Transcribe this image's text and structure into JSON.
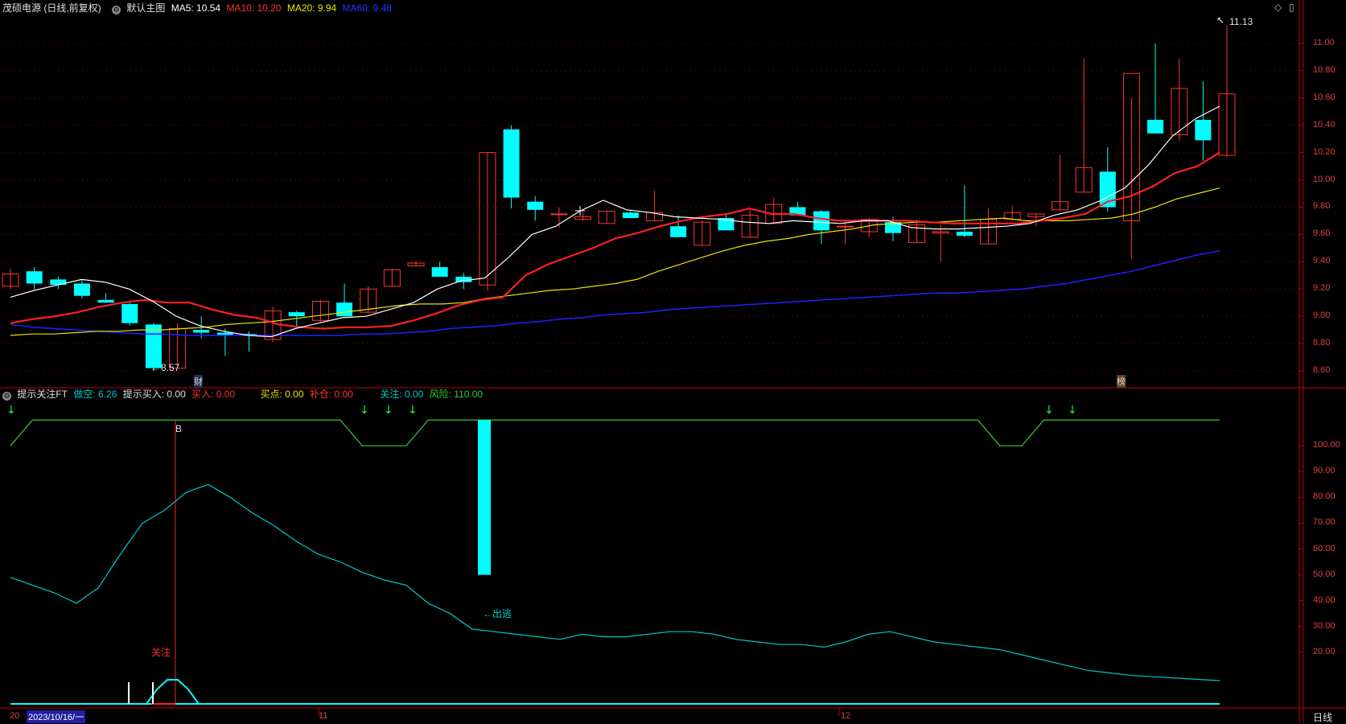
{
  "header": {
    "stock_title": "茂硕电源 (日线,前复权)",
    "main_chart_name": "默认主图",
    "ma5": "MA5: 10.54",
    "ma10": "MA10: 10.20",
    "ma20": "MA20: 9.94",
    "ma60": "MA60: 9.48"
  },
  "sub_header": {
    "indicator_name": "提示关注FT",
    "short": "做空: 6.26",
    "hint_buy": "提示买入: 0.00",
    "buy": "买入: 0.00",
    "buy_point": "买点: 0.00",
    "add": "补仓: 0.00",
    "watch": "关注: 0.00",
    "risk": "风险: 110.00"
  },
  "colors": {
    "up": "#ff3333",
    "down": "#00ffff",
    "ma5": "#ffffff",
    "ma10": "#ff2020",
    "ma20": "#e6e600",
    "ma60": "#2020ff",
    "grid": "#5a0000",
    "axis": "#c00000",
    "osc": "#00c8c8",
    "risk": "#33cc33",
    "arrow": "#33ee33"
  },
  "annotations": {
    "high_label": "11.13",
    "low_label": "8.57",
    "finance_mark": "财",
    "rank_mark": "榜",
    "b_mark": "B",
    "watch_mark": "关注",
    "escape_label": "←出逃"
  },
  "x_axis": {
    "labels": [
      "11",
      "12"
    ],
    "cursor_date": "2023/10/16/一",
    "left_stub": "20",
    "period": "日线"
  },
  "chart_data": [
    {
      "type": "candlestick",
      "ylim": [
        8.5,
        11.2
      ],
      "yticks": [
        "11.00",
        "10.80",
        "10.60",
        "10.40",
        "10.20",
        "10.00",
        "9.80",
        "9.60",
        "9.40",
        "9.20",
        "9.00",
        "8.80",
        "8.60"
      ],
      "ohlc": [
        [
          9.22,
          9.35,
          9.2,
          9.31
        ],
        [
          9.33,
          9.36,
          9.2,
          9.24
        ],
        [
          9.27,
          9.29,
          9.2,
          9.23
        ],
        [
          9.24,
          9.27,
          9.13,
          9.15
        ],
        [
          9.12,
          9.17,
          9.1,
          9.1
        ],
        [
          9.09,
          9.1,
          8.93,
          8.95
        ],
        [
          8.94,
          8.95,
          8.6,
          8.62
        ],
        [
          8.62,
          8.95,
          8.62,
          8.91
        ],
        [
          8.9,
          9.0,
          8.84,
          8.88
        ],
        [
          8.88,
          8.91,
          8.71,
          8.86
        ],
        [
          8.87,
          8.89,
          8.74,
          8.86
        ],
        [
          8.83,
          9.07,
          8.81,
          9.04
        ],
        [
          9.03,
          9.04,
          8.92,
          9.0
        ],
        [
          8.97,
          9.12,
          8.96,
          9.11
        ],
        [
          9.1,
          9.24,
          9.0,
          9.0
        ],
        [
          9.03,
          9.22,
          9.02,
          9.2
        ],
        [
          9.22,
          9.35,
          9.22,
          9.34
        ],
        [
          9.37,
          9.4,
          9.37,
          9.39
        ],
        [
          9.36,
          9.4,
          9.29,
          9.29
        ],
        [
          9.29,
          9.32,
          9.2,
          9.25
        ],
        [
          9.23,
          10.2,
          9.19,
          10.2
        ],
        [
          10.37,
          10.4,
          9.79,
          9.87
        ],
        [
          9.84,
          9.88,
          9.7,
          9.78
        ],
        [
          9.75,
          9.8,
          9.65,
          9.75
        ],
        [
          9.71,
          9.76,
          9.7,
          9.73
        ],
        [
          9.68,
          9.77,
          9.68,
          9.77
        ],
        [
          9.76,
          9.77,
          9.73,
          9.72
        ],
        [
          9.7,
          9.92,
          9.7,
          9.76
        ],
        [
          9.66,
          9.74,
          9.59,
          9.58
        ],
        [
          9.52,
          9.7,
          9.52,
          9.69
        ],
        [
          9.72,
          9.75,
          9.63,
          9.63
        ],
        [
          9.58,
          9.78,
          9.58,
          9.74
        ],
        [
          9.68,
          9.87,
          9.68,
          9.82
        ],
        [
          9.8,
          9.84,
          9.74,
          9.74
        ],
        [
          9.77,
          9.78,
          9.53,
          9.63
        ],
        [
          9.66,
          9.69,
          9.53,
          9.66
        ],
        [
          9.62,
          9.72,
          9.58,
          9.71
        ],
        [
          9.69,
          9.73,
          9.55,
          9.61
        ],
        [
          9.54,
          9.71,
          9.54,
          9.67
        ],
        [
          9.61,
          9.67,
          9.4,
          9.62
        ],
        [
          9.62,
          9.96,
          9.58,
          9.59
        ],
        [
          9.53,
          9.79,
          9.53,
          9.71
        ],
        [
          9.71,
          9.81,
          9.7,
          9.76
        ],
        [
          9.73,
          9.75,
          9.66,
          9.75
        ],
        [
          9.78,
          10.18,
          9.78,
          9.84
        ],
        [
          9.91,
          10.89,
          9.91,
          10.09
        ],
        [
          10.06,
          10.24,
          9.77,
          9.8
        ],
        [
          9.7,
          10.6,
          9.42,
          10.78
        ],
        [
          10.44,
          11.0,
          10.34,
          10.34
        ],
        [
          10.33,
          10.89,
          10.29,
          10.67
        ],
        [
          10.44,
          10.72,
          10.14,
          10.29
        ],
        [
          10.18,
          11.13,
          10.17,
          10.63
        ]
      ],
      "ma5": [
        9.14,
        9.19,
        9.23,
        9.27,
        9.25,
        9.2,
        9.11,
        9.0,
        8.93,
        8.89,
        8.86,
        8.85,
        8.91,
        8.95,
        8.99,
        9.0,
        9.05,
        9.1,
        9.2,
        9.26,
        9.28,
        9.43,
        9.6,
        9.66,
        9.77,
        9.85,
        9.78,
        9.76,
        9.73,
        9.72,
        9.71,
        9.69,
        9.68,
        9.7,
        9.69,
        9.68,
        9.7,
        9.7,
        9.65,
        9.64,
        9.64,
        9.65,
        9.66,
        9.68,
        9.74,
        9.78,
        9.85,
        9.94,
        10.11,
        10.32,
        10.45,
        10.54
      ],
      "ma10": [
        8.95,
        8.98,
        9.0,
        9.03,
        9.07,
        9.1,
        9.12,
        9.1,
        9.1,
        9.05,
        9.01,
        8.99,
        8.94,
        8.92,
        8.91,
        8.92,
        8.92,
        8.93,
        8.97,
        9.02,
        9.08,
        9.12,
        9.14,
        9.3,
        9.38,
        9.44,
        9.5,
        9.57,
        9.61,
        9.66,
        9.7,
        9.73,
        9.75,
        9.79,
        9.75,
        9.75,
        9.72,
        9.7,
        9.7,
        9.7,
        9.7,
        9.69,
        9.68,
        9.68,
        9.68,
        9.68,
        9.7,
        9.72,
        9.75,
        9.84,
        9.88,
        9.95,
        10.05,
        10.1,
        10.2
      ],
      "ma20": [
        8.86,
        8.87,
        8.87,
        8.88,
        8.89,
        8.89,
        8.9,
        8.9,
        8.91,
        8.92,
        8.94,
        8.95,
        8.96,
        8.98,
        9.0,
        9.02,
        9.04,
        9.06,
        9.08,
        9.09,
        9.09,
        9.1,
        9.13,
        9.15,
        9.17,
        9.19,
        9.2,
        9.22,
        9.24,
        9.27,
        9.33,
        9.38,
        9.43,
        9.48,
        9.52,
        9.55,
        9.57,
        9.6,
        9.62,
        9.64,
        9.67,
        9.68,
        9.69,
        9.69,
        9.7,
        9.71,
        9.72,
        9.7,
        9.7,
        9.7,
        9.71,
        9.72,
        9.75,
        9.8,
        9.86,
        9.9,
        9.94
      ],
      "ma60": [
        8.94,
        8.92,
        8.91,
        8.9,
        8.89,
        8.88,
        8.87,
        8.87,
        8.86,
        8.86,
        8.86,
        8.86,
        8.86,
        8.86,
        8.86,
        8.86,
        8.87,
        8.87,
        8.88,
        8.89,
        8.91,
        8.92,
        8.93,
        8.95,
        8.96,
        8.98,
        8.99,
        9.01,
        9.02,
        9.03,
        9.05,
        9.06,
        9.07,
        9.08,
        9.09,
        9.1,
        9.11,
        9.12,
        9.13,
        9.14,
        9.15,
        9.16,
        9.17,
        9.17,
        9.18,
        9.19,
        9.2,
        9.22,
        9.24,
        9.27,
        9.3,
        9.33,
        9.37,
        9.41,
        9.45,
        9.48
      ]
    },
    {
      "type": "line",
      "name": "提示关注FT",
      "ylim": [
        0,
        120
      ],
      "yticks": [
        "100.00",
        "90.00",
        "80.00",
        "70.00",
        "60.00",
        "50.00",
        "40.00",
        "30.00",
        "20.00"
      ],
      "oscillator": [
        49,
        46,
        43,
        39,
        45,
        58,
        70,
        75,
        82,
        85,
        80,
        74,
        69,
        63,
        58,
        55,
        51,
        48,
        46,
        39,
        35,
        29,
        28,
        27,
        26,
        25,
        27,
        26,
        26,
        27,
        28,
        28,
        27,
        25,
        24,
        23,
        23,
        22,
        24,
        27,
        28,
        26,
        24,
        23,
        22,
        21,
        19,
        17,
        15,
        13,
        12,
        11,
        10.5,
        10,
        9.5,
        9
      ],
      "risk_line": [
        100,
        110,
        110,
        110,
        110,
        110,
        110,
        110,
        110,
        110,
        110,
        110,
        110,
        110,
        110,
        110,
        100,
        100,
        100,
        110,
        110,
        110,
        110,
        110,
        110,
        110,
        110,
        110,
        110,
        110,
        110,
        110,
        110,
        110,
        110,
        110,
        110,
        110,
        110,
        110,
        110,
        110,
        110,
        110,
        110,
        100,
        100,
        110,
        110,
        110,
        110,
        110,
        110,
        110,
        110,
        110
      ],
      "short_bar": {
        "index": 20,
        "top": 110,
        "bottom": 50
      },
      "watch_spike": [
        0,
        0,
        0,
        0,
        0,
        6,
        10,
        10,
        6,
        0,
        0
      ]
    }
  ]
}
